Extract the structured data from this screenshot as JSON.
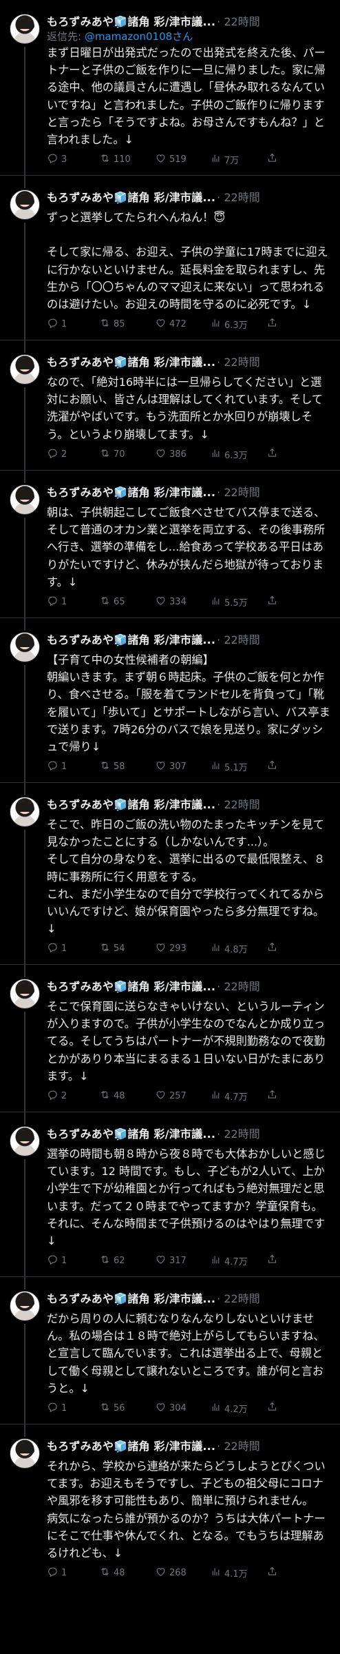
{
  "tweets": [
    {
      "author": "もろずみあや🧊諸角 彩/津市議...",
      "meta": "· 22時間",
      "replying_label": "返信先: ",
      "replying_handle": "@mamazon0108さん",
      "body": "まず日曜日が出発式だったので出発式を終えた後、パートナーと子供のご飯を作りに一旦に帰りました。家に帰る途中、他の議員さんに遭遇し「昼休み取れるなんていいですね」と言われました。子供のご飯作りに帰りますと言ったら「そうですよね。お母さんですもんね？」と言われました。↓",
      "replies": "3",
      "retweets": "110",
      "likes": "519",
      "views": "7万"
    },
    {
      "author": "もろずみあや🧊諸角 彩/津市議...",
      "meta": "· 22時間",
      "body": "ずっと選挙してたられへんねん！😇\n\nそして家に帰る、お迎え、子供の学童に17時までに迎えに行かないといけません。延長料金を取られますし、先生から「〇〇ちゃんのママ迎えに来ない」って思われるのは避けたい。お迎えの時間を守るのに必死です。↓",
      "replies": "1",
      "retweets": "85",
      "likes": "472",
      "views": "6.3万"
    },
    {
      "author": "もろずみあや🧊諸角 彩/津市議...",
      "meta": "· 22時間",
      "body": "なので、「絶対16時半には一旦帰らしてください」と選対にお願い、皆さんは理解はしてくれています。そして洗濯がやばいです。もう洗面所とか水回りが崩壊しそう。というより崩壊してます。↓",
      "replies": "2",
      "retweets": "70",
      "likes": "386",
      "views": "6.3万"
    },
    {
      "author": "もろずみあや🧊諸角 彩/津市議...",
      "meta": "· 22時間",
      "body": "朝は、子供朝起こしてご飯食べさせてバス停まで送る、そして普通のオカン業と選挙を両立する、その後事務所へ行き、選挙の準備をし...給食あって学校ある平日はありがたいですけど、休みが挟んだら地獄が待っております。↓",
      "replies": "1",
      "retweets": "65",
      "likes": "334",
      "views": "5.5万"
    },
    {
      "author": "もろずみあや🧊諸角 彩/津市議...",
      "meta": "· 22時間",
      "body": "【子育て中の女性候補者の朝編】\n朝編いきます。まず朝６時起床。子供のご飯を何とか作り、食べさせる。「服を着てランドセルを背負って」「靴を履いて」「歩いて」とサポートしながら言い、バス亭まで送ります。7時26分のバスで娘を見送り。家にダッシュで帰り↓",
      "replies": "1",
      "retweets": "58",
      "likes": "307",
      "views": "5.1万"
    },
    {
      "author": "もろずみあや🧊諸角 彩/津市議...",
      "meta": "· 22時間",
      "body": "そこで、昨日のご飯の洗い物のたまったキッチンを見て見なかったことにする（しかないんです...）。\nそして自分の身なりを、選挙に出るので最低限整え、８時に事務所に行く用意をする。\nこれ、まだ小学生なので自分で学校行ってくれてるからいいんですけど、娘が保育園やったら多分無理ですね。↓",
      "replies": "1",
      "retweets": "54",
      "likes": "293",
      "views": "4.8万"
    },
    {
      "author": "もろずみあや🧊諸角 彩/津市議...",
      "meta": "· 22時間",
      "body": "そこで保育園に送らなきゃいけない、というルーティンが入りますので。子供が小学生なのでなんとか成り立ってる。そしてうちはパートナーが不規則勤務なので夜勤とかがありり本当にまるまる１日いない日がたまにあります。↓",
      "replies": "2",
      "retweets": "48",
      "likes": "257",
      "views": "4.7万"
    },
    {
      "author": "もろずみあや🧊諸角 彩/津市議...",
      "meta": "· 22時間",
      "body": "選挙の時間も朝８時から夜８時でも大体おかしいと感じています。12 時間です。もし、子どもが2人いて、上か小学生で下が幼稚園とか行ってればもう絶対無理だと思います。だって２０時までやってますか？学童保育も。それに、そんな時間まで子供預けるのはやはり無理です↓",
      "replies": "1",
      "retweets": "62",
      "likes": "317",
      "views": "4.7万"
    },
    {
      "author": "もろずみあや🧊諸角 彩/津市議...",
      "meta": "· 22時間",
      "body": "だから周りの人に頼むなりなんなりしないといけません。私の場合は１８時で絶対上がらしてもらいますね、と宣言して臨んでいます。これは選挙出る上で、母親として働く母親として譲れないところです。誰が何と言おうと。↓",
      "replies": "1",
      "retweets": "56",
      "likes": "304",
      "views": "4.2万"
    },
    {
      "author": "もろずみあや🧊諸角 彩/津市議...",
      "meta": "· 22時間",
      "body": "それから、学校から連絡が来たらどうしようとびくついてます。お迎えもそうですし、子どもの祖父母にコロナや風邪を移す可能性もあり、簡単に預けられません。\n病気になったら誰が預かるのか？うちは大体パートナーにそこで仕事や休んでくれ、となる。でもうちは理解あるけれども、↓",
      "replies": "1",
      "retweets": "48",
      "likes": "268",
      "views": "4.1万"
    }
  ],
  "icons": {
    "reply": "reply-icon",
    "retweet": "retweet-icon",
    "like": "heart-icon",
    "views": "views-icon",
    "share": "share-icon"
  },
  "colors": {
    "background": "#000000",
    "text": "#e7e9ea",
    "muted": "#71767b",
    "link": "#1d9bf0"
  }
}
